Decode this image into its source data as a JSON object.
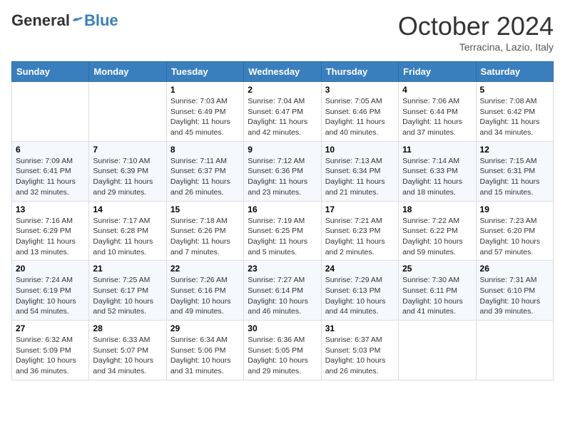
{
  "header": {
    "logo_general": "General",
    "logo_blue": "Blue",
    "month_title": "October 2024",
    "subtitle": "Terracina, Lazio, Italy"
  },
  "days_of_week": [
    "Sunday",
    "Monday",
    "Tuesday",
    "Wednesday",
    "Thursday",
    "Friday",
    "Saturday"
  ],
  "weeks": [
    [
      {
        "day": "",
        "sunrise": "",
        "sunset": "",
        "daylight": ""
      },
      {
        "day": "",
        "sunrise": "",
        "sunset": "",
        "daylight": ""
      },
      {
        "day": "1",
        "sunrise": "Sunrise: 7:03 AM",
        "sunset": "Sunset: 6:49 PM",
        "daylight": "Daylight: 11 hours and 45 minutes."
      },
      {
        "day": "2",
        "sunrise": "Sunrise: 7:04 AM",
        "sunset": "Sunset: 6:47 PM",
        "daylight": "Daylight: 11 hours and 42 minutes."
      },
      {
        "day": "3",
        "sunrise": "Sunrise: 7:05 AM",
        "sunset": "Sunset: 6:46 PM",
        "daylight": "Daylight: 11 hours and 40 minutes."
      },
      {
        "day": "4",
        "sunrise": "Sunrise: 7:06 AM",
        "sunset": "Sunset: 6:44 PM",
        "daylight": "Daylight: 11 hours and 37 minutes."
      },
      {
        "day": "5",
        "sunrise": "Sunrise: 7:08 AM",
        "sunset": "Sunset: 6:42 PM",
        "daylight": "Daylight: 11 hours and 34 minutes."
      }
    ],
    [
      {
        "day": "6",
        "sunrise": "Sunrise: 7:09 AM",
        "sunset": "Sunset: 6:41 PM",
        "daylight": "Daylight: 11 hours and 32 minutes."
      },
      {
        "day": "7",
        "sunrise": "Sunrise: 7:10 AM",
        "sunset": "Sunset: 6:39 PM",
        "daylight": "Daylight: 11 hours and 29 minutes."
      },
      {
        "day": "8",
        "sunrise": "Sunrise: 7:11 AM",
        "sunset": "Sunset: 6:37 PM",
        "daylight": "Daylight: 11 hours and 26 minutes."
      },
      {
        "day": "9",
        "sunrise": "Sunrise: 7:12 AM",
        "sunset": "Sunset: 6:36 PM",
        "daylight": "Daylight: 11 hours and 23 minutes."
      },
      {
        "day": "10",
        "sunrise": "Sunrise: 7:13 AM",
        "sunset": "Sunset: 6:34 PM",
        "daylight": "Daylight: 11 hours and 21 minutes."
      },
      {
        "day": "11",
        "sunrise": "Sunrise: 7:14 AM",
        "sunset": "Sunset: 6:33 PM",
        "daylight": "Daylight: 11 hours and 18 minutes."
      },
      {
        "day": "12",
        "sunrise": "Sunrise: 7:15 AM",
        "sunset": "Sunset: 6:31 PM",
        "daylight": "Daylight: 11 hours and 15 minutes."
      }
    ],
    [
      {
        "day": "13",
        "sunrise": "Sunrise: 7:16 AM",
        "sunset": "Sunset: 6:29 PM",
        "daylight": "Daylight: 11 hours and 13 minutes."
      },
      {
        "day": "14",
        "sunrise": "Sunrise: 7:17 AM",
        "sunset": "Sunset: 6:28 PM",
        "daylight": "Daylight: 11 hours and 10 minutes."
      },
      {
        "day": "15",
        "sunrise": "Sunrise: 7:18 AM",
        "sunset": "Sunset: 6:26 PM",
        "daylight": "Daylight: 11 hours and 7 minutes."
      },
      {
        "day": "16",
        "sunrise": "Sunrise: 7:19 AM",
        "sunset": "Sunset: 6:25 PM",
        "daylight": "Daylight: 11 hours and 5 minutes."
      },
      {
        "day": "17",
        "sunrise": "Sunrise: 7:21 AM",
        "sunset": "Sunset: 6:23 PM",
        "daylight": "Daylight: 11 hours and 2 minutes."
      },
      {
        "day": "18",
        "sunrise": "Sunrise: 7:22 AM",
        "sunset": "Sunset: 6:22 PM",
        "daylight": "Daylight: 10 hours and 59 minutes."
      },
      {
        "day": "19",
        "sunrise": "Sunrise: 7:23 AM",
        "sunset": "Sunset: 6:20 PM",
        "daylight": "Daylight: 10 hours and 57 minutes."
      }
    ],
    [
      {
        "day": "20",
        "sunrise": "Sunrise: 7:24 AM",
        "sunset": "Sunset: 6:19 PM",
        "daylight": "Daylight: 10 hours and 54 minutes."
      },
      {
        "day": "21",
        "sunrise": "Sunrise: 7:25 AM",
        "sunset": "Sunset: 6:17 PM",
        "daylight": "Daylight: 10 hours and 52 minutes."
      },
      {
        "day": "22",
        "sunrise": "Sunrise: 7:26 AM",
        "sunset": "Sunset: 6:16 PM",
        "daylight": "Daylight: 10 hours and 49 minutes."
      },
      {
        "day": "23",
        "sunrise": "Sunrise: 7:27 AM",
        "sunset": "Sunset: 6:14 PM",
        "daylight": "Daylight: 10 hours and 46 minutes."
      },
      {
        "day": "24",
        "sunrise": "Sunrise: 7:29 AM",
        "sunset": "Sunset: 6:13 PM",
        "daylight": "Daylight: 10 hours and 44 minutes."
      },
      {
        "day": "25",
        "sunrise": "Sunrise: 7:30 AM",
        "sunset": "Sunset: 6:11 PM",
        "daylight": "Daylight: 10 hours and 41 minutes."
      },
      {
        "day": "26",
        "sunrise": "Sunrise: 7:31 AM",
        "sunset": "Sunset: 6:10 PM",
        "daylight": "Daylight: 10 hours and 39 minutes."
      }
    ],
    [
      {
        "day": "27",
        "sunrise": "Sunrise: 6:32 AM",
        "sunset": "Sunset: 5:09 PM",
        "daylight": "Daylight: 10 hours and 36 minutes."
      },
      {
        "day": "28",
        "sunrise": "Sunrise: 6:33 AM",
        "sunset": "Sunset: 5:07 PM",
        "daylight": "Daylight: 10 hours and 34 minutes."
      },
      {
        "day": "29",
        "sunrise": "Sunrise: 6:34 AM",
        "sunset": "Sunset: 5:06 PM",
        "daylight": "Daylight: 10 hours and 31 minutes."
      },
      {
        "day": "30",
        "sunrise": "Sunrise: 6:36 AM",
        "sunset": "Sunset: 5:05 PM",
        "daylight": "Daylight: 10 hours and 29 minutes."
      },
      {
        "day": "31",
        "sunrise": "Sunrise: 6:37 AM",
        "sunset": "Sunset: 5:03 PM",
        "daylight": "Daylight: 10 hours and 26 minutes."
      },
      {
        "day": "",
        "sunrise": "",
        "sunset": "",
        "daylight": ""
      },
      {
        "day": "",
        "sunrise": "",
        "sunset": "",
        "daylight": ""
      }
    ]
  ]
}
